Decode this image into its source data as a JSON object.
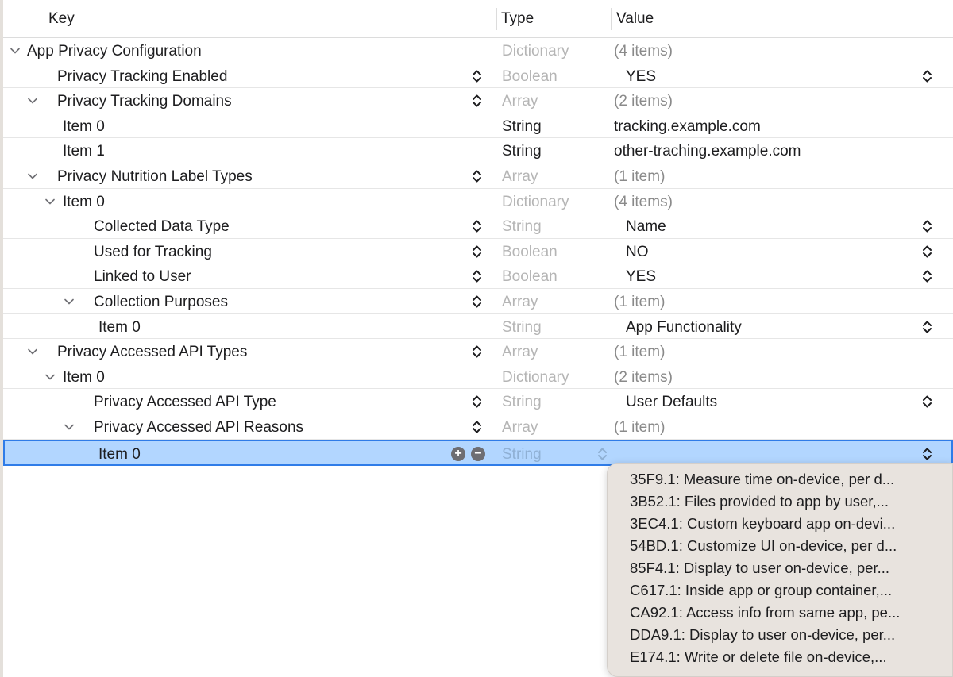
{
  "header": {
    "key": "Key",
    "type": "Type",
    "value": "Value"
  },
  "rows": [
    {
      "key": "App Privacy Configuration",
      "type": "Dictionary",
      "value": "(4 items)"
    },
    {
      "key": "Privacy Tracking Enabled",
      "type": "Boolean",
      "value": "YES"
    },
    {
      "key": "Privacy Tracking Domains",
      "type": "Array",
      "value": "(2 items)"
    },
    {
      "key": "Item 0",
      "type": "String",
      "value": "tracking.example.com"
    },
    {
      "key": "Item 1",
      "type": "String",
      "value": "other-traching.example.com"
    },
    {
      "key": "Privacy Nutrition Label Types",
      "type": "Array",
      "value": "(1 item)"
    },
    {
      "key": "Item 0",
      "type": "Dictionary",
      "value": "(4 items)"
    },
    {
      "key": "Collected Data Type",
      "type": "String",
      "value": "Name"
    },
    {
      "key": "Used for Tracking",
      "type": "Boolean",
      "value": "NO"
    },
    {
      "key": "Linked to User",
      "type": "Boolean",
      "value": "YES"
    },
    {
      "key": "Collection Purposes",
      "type": "Array",
      "value": "(1 item)"
    },
    {
      "key": "Item 0",
      "type": "String",
      "value": "App Functionality"
    },
    {
      "key": "Privacy Accessed API Types",
      "type": "Array",
      "value": "(1 item)"
    },
    {
      "key": "Item 0",
      "type": "Dictionary",
      "value": "(2 items)"
    },
    {
      "key": "Privacy Accessed API Type",
      "type": "String",
      "value": "User Defaults"
    },
    {
      "key": "Privacy Accessed API Reasons",
      "type": "Array",
      "value": "(1 item)"
    },
    {
      "key": "Item 0",
      "type": "String",
      "value": ""
    }
  ],
  "popup": {
    "options": [
      "35F9.1: Measure time on-device, per d...",
      "3B52.1: Files provided to app by user,...",
      "3EC4.1: Custom keyboard app on-devi...",
      "54BD.1: Customize UI on-device, per d...",
      "85F4.1: Display to user on-device, per...",
      "C617.1: Inside app or group container,...",
      "CA92.1: Access info from same app, pe...",
      "DDA9.1: Display to user on-device, per...",
      "E174.1: Write or delete file on-device,..."
    ]
  },
  "icons": {
    "add": "plus-circle-icon",
    "remove": "minus-circle-icon",
    "stepper": "updown-chevron-icon",
    "disclosure": "chevron-down-icon"
  },
  "colors": {
    "selection_bg": "#b2d6ff",
    "selection_border": "#2f7ce8",
    "popup_bg": "#e8e3de"
  }
}
